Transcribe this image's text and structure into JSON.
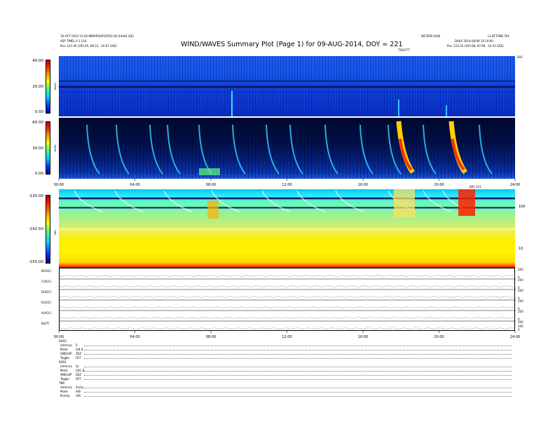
{
  "header": {
    "left_line1": "10-OCT-2014 15:00 BBPARSHP(SP10) (K) 64x64 (SE)",
    "left_line2": "ASP TIMEL 0.1 CLK",
    "left_pos": "Pos: 223.46 (205.45, 88.31, -10.07 GSE)",
    "title": "WIND/WAVES Summary Plot (Page 1) for 09-AUG-2014, DOY = 221",
    "center_right_top": "WF/ZEN 2440",
    "center_right_sub": "TDS/FFT",
    "right_top": "L3 BFTONE 501",
    "right_line2": "DAILY 2014-08-09 14:10:00",
    "right_pos": "Pos: 223.52 (205.68, 87.66, -10.51 GSE)",
    "corner_right": "EH1"
  },
  "chart_data": [
    {
      "type": "heatmap",
      "panel": "RAD2",
      "ylabel": "RAD2",
      "yticks": [
        "40.00",
        "20.00",
        "0.00"
      ],
      "ylim": [
        0,
        40
      ]
    },
    {
      "type": "heatmap",
      "panel": "RAD1",
      "ylabel": "RAD1",
      "yticks": [
        "60.00",
        "30.00",
        "0.00"
      ],
      "ylim": [
        0,
        60
      ],
      "xticks": [
        "00:00",
        "04:00",
        "08:00",
        "12:00",
        "16:00",
        "20:00",
        "24:00"
      ],
      "xlabel_right": "BAY 221"
    },
    {
      "type": "heatmap",
      "panel": "TNR",
      "ylabel": "TNR",
      "yticks": [
        "-130.00",
        "-142.50",
        "-155.00"
      ],
      "ylim": [
        -155,
        -130
      ],
      "right_ticks": [
        "100",
        "10"
      ]
    },
    {
      "type": "line",
      "panel": "housekeeping",
      "rows": [
        {
          "label": "B(AGC)",
          "right_ticks": [
            "200",
            "0"
          ]
        },
        {
          "label": "C(AGC)",
          "right_ticks": [
            "200",
            "0"
          ]
        },
        {
          "label": "D(AGC)",
          "right_ticks": [
            "200",
            "0"
          ]
        },
        {
          "label": "E(AGC)",
          "right_ticks": [
            "200",
            "0"
          ]
        },
        {
          "label": "A(AGC)",
          "right_ticks": [
            "200",
            "0"
          ]
        },
        {
          "label": "B(OT)",
          "right_ticks": [
            "200",
            "100",
            "0"
          ]
        }
      ],
      "xticks": [
        "00:00",
        "04:00",
        "08:00",
        "12:00",
        "16:00",
        "20:00",
        "24:00"
      ]
    }
  ],
  "footer": {
    "block1_title": "RAD2",
    "block1": [
      {
        "k": "Antenna",
        "v": "S"
      },
      {
        "k": "Mode",
        "v": "LIN 8"
      },
      {
        "k": "SMEGSP",
        "v": "ZEZ"
      },
      {
        "k": "Toggle",
        "v": "OFF"
      }
    ],
    "block2_title": "RAD1",
    "block2": [
      {
        "k": "Antenna",
        "v": "Sc"
      },
      {
        "k": "Mode",
        "v": "LOG 8"
      },
      {
        "k": "SMEGSP",
        "v": "ZEZ"
      },
      {
        "k": "Toggle",
        "v": "OFF"
      }
    ],
    "block3_title": "TNR",
    "block3": [
      {
        "k": "Antenna",
        "v": "Sx/Sy"
      },
      {
        "k": "Mode",
        "v": "A/B"
      },
      {
        "k": "Bcomp",
        "v": "A/B"
      }
    ]
  }
}
